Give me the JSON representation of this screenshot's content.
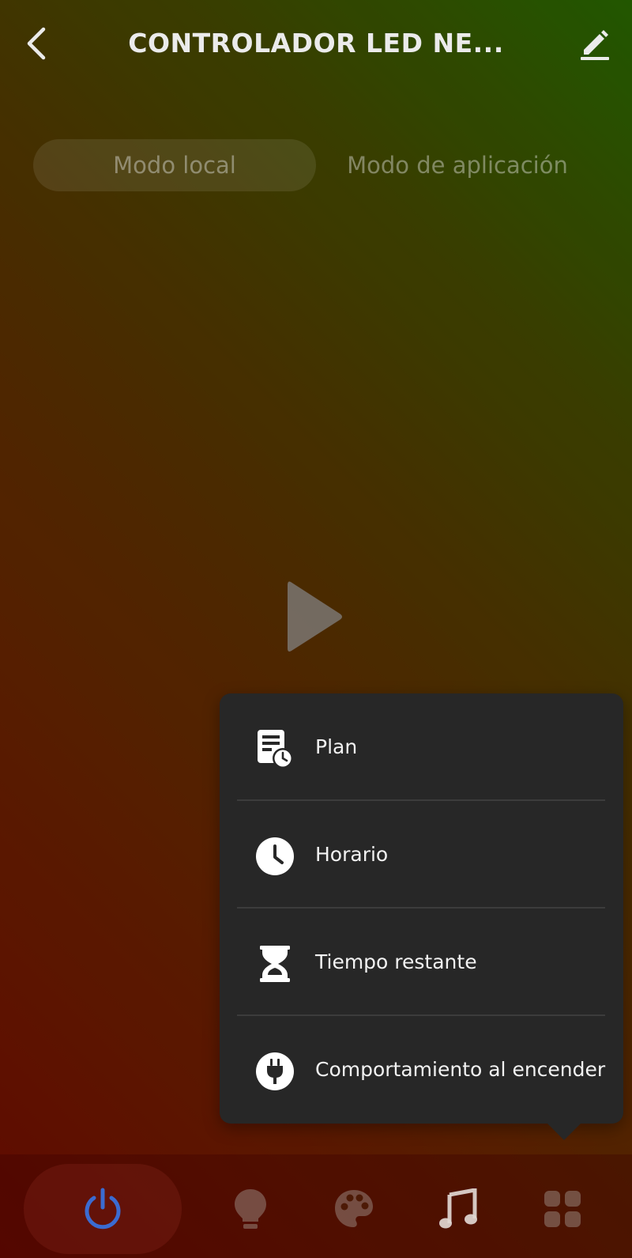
{
  "header": {
    "title": "CONTROLADOR LED NE...",
    "back_icon": "chevron-left-icon",
    "edit_icon": "pencil-icon"
  },
  "mode_tabs": {
    "selected": "Modo local",
    "items": [
      {
        "label": "Modo local"
      },
      {
        "label": "Modo de aplicación"
      }
    ]
  },
  "main": {
    "play_icon": "play-icon"
  },
  "popup_menu": {
    "items": [
      {
        "label": "Plan",
        "icon": "schedule-plan-icon"
      },
      {
        "label": "Horario",
        "icon": "clock-icon"
      },
      {
        "label": "Tiempo restante",
        "icon": "hourglass-icon"
      },
      {
        "label": "Comportamiento al encender",
        "icon": "power-plug-icon"
      }
    ]
  },
  "bottom_nav": {
    "items": [
      {
        "icon": "power-icon",
        "active": true
      },
      {
        "icon": "lightbulb-icon"
      },
      {
        "icon": "palette-icon"
      },
      {
        "icon": "music-note-icon"
      },
      {
        "icon": "grid-menu-icon"
      }
    ]
  },
  "colors": {
    "popup_bg": "#272727",
    "power_icon": "#3b6bd1",
    "text_primary": "#ffffff",
    "tab_text": "rgba(255,255,255,0.42)"
  }
}
